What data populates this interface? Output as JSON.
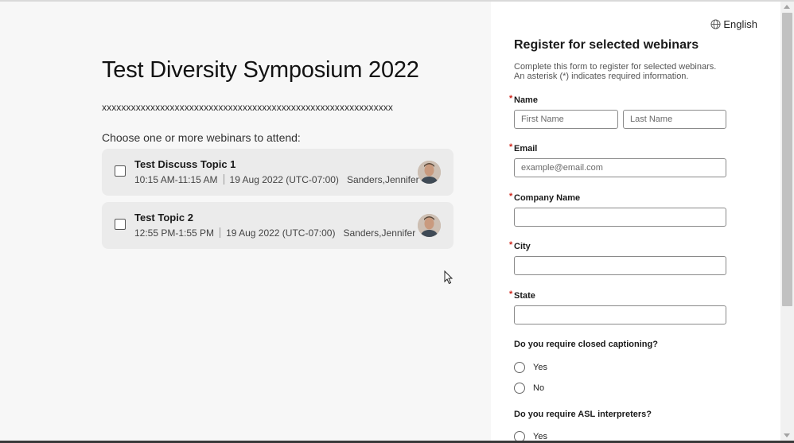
{
  "event": {
    "title": "Test Diversity Symposium 2022",
    "description": "xxxxxxxxxxxxxxxxxxxxxxxxxxxxxxxxxxxxxxxxxxxxxxxxxxxxxxxxxxxx",
    "choose_prompt": "Choose one or more webinars to attend:"
  },
  "webinars": [
    {
      "title": "Test Discuss Topic 1",
      "time": "10:15 AM-11:15 AM",
      "date": "19 Aug 2022 (UTC-07:00)",
      "host": "Sanders,Jennifer",
      "checked": false
    },
    {
      "title": "Test Topic 2",
      "time": "12:55 PM-1:55 PM",
      "date": "19 Aug 2022 (UTC-07:00)",
      "host": "Sanders,Jennifer",
      "checked": false
    }
  ],
  "language": {
    "label": "English",
    "icon": "globe-icon"
  },
  "form": {
    "title": "Register for selected webinars",
    "description_line1": "Complete this form to register for selected webinars.",
    "description_line2": "An asterisk (*) indicates required information.",
    "required_marker": "*",
    "name": {
      "label": "Name",
      "first_placeholder": "First Name",
      "last_placeholder": "Last Name"
    },
    "email": {
      "label": "Email",
      "placeholder": "example@email.com"
    },
    "company": {
      "label": "Company Name",
      "placeholder": ""
    },
    "city": {
      "label": "City",
      "placeholder": ""
    },
    "state": {
      "label": "State",
      "placeholder": ""
    },
    "captioning": {
      "label": "Do you require closed captioning?",
      "options": [
        "Yes",
        "No"
      ]
    },
    "asl": {
      "label": "Do you require ASL interpreters?",
      "options": [
        "Yes"
      ]
    }
  },
  "colors": {
    "required": "#d0271d",
    "card_bg": "#ebebeb",
    "page_bg": "#f7f7f7"
  }
}
